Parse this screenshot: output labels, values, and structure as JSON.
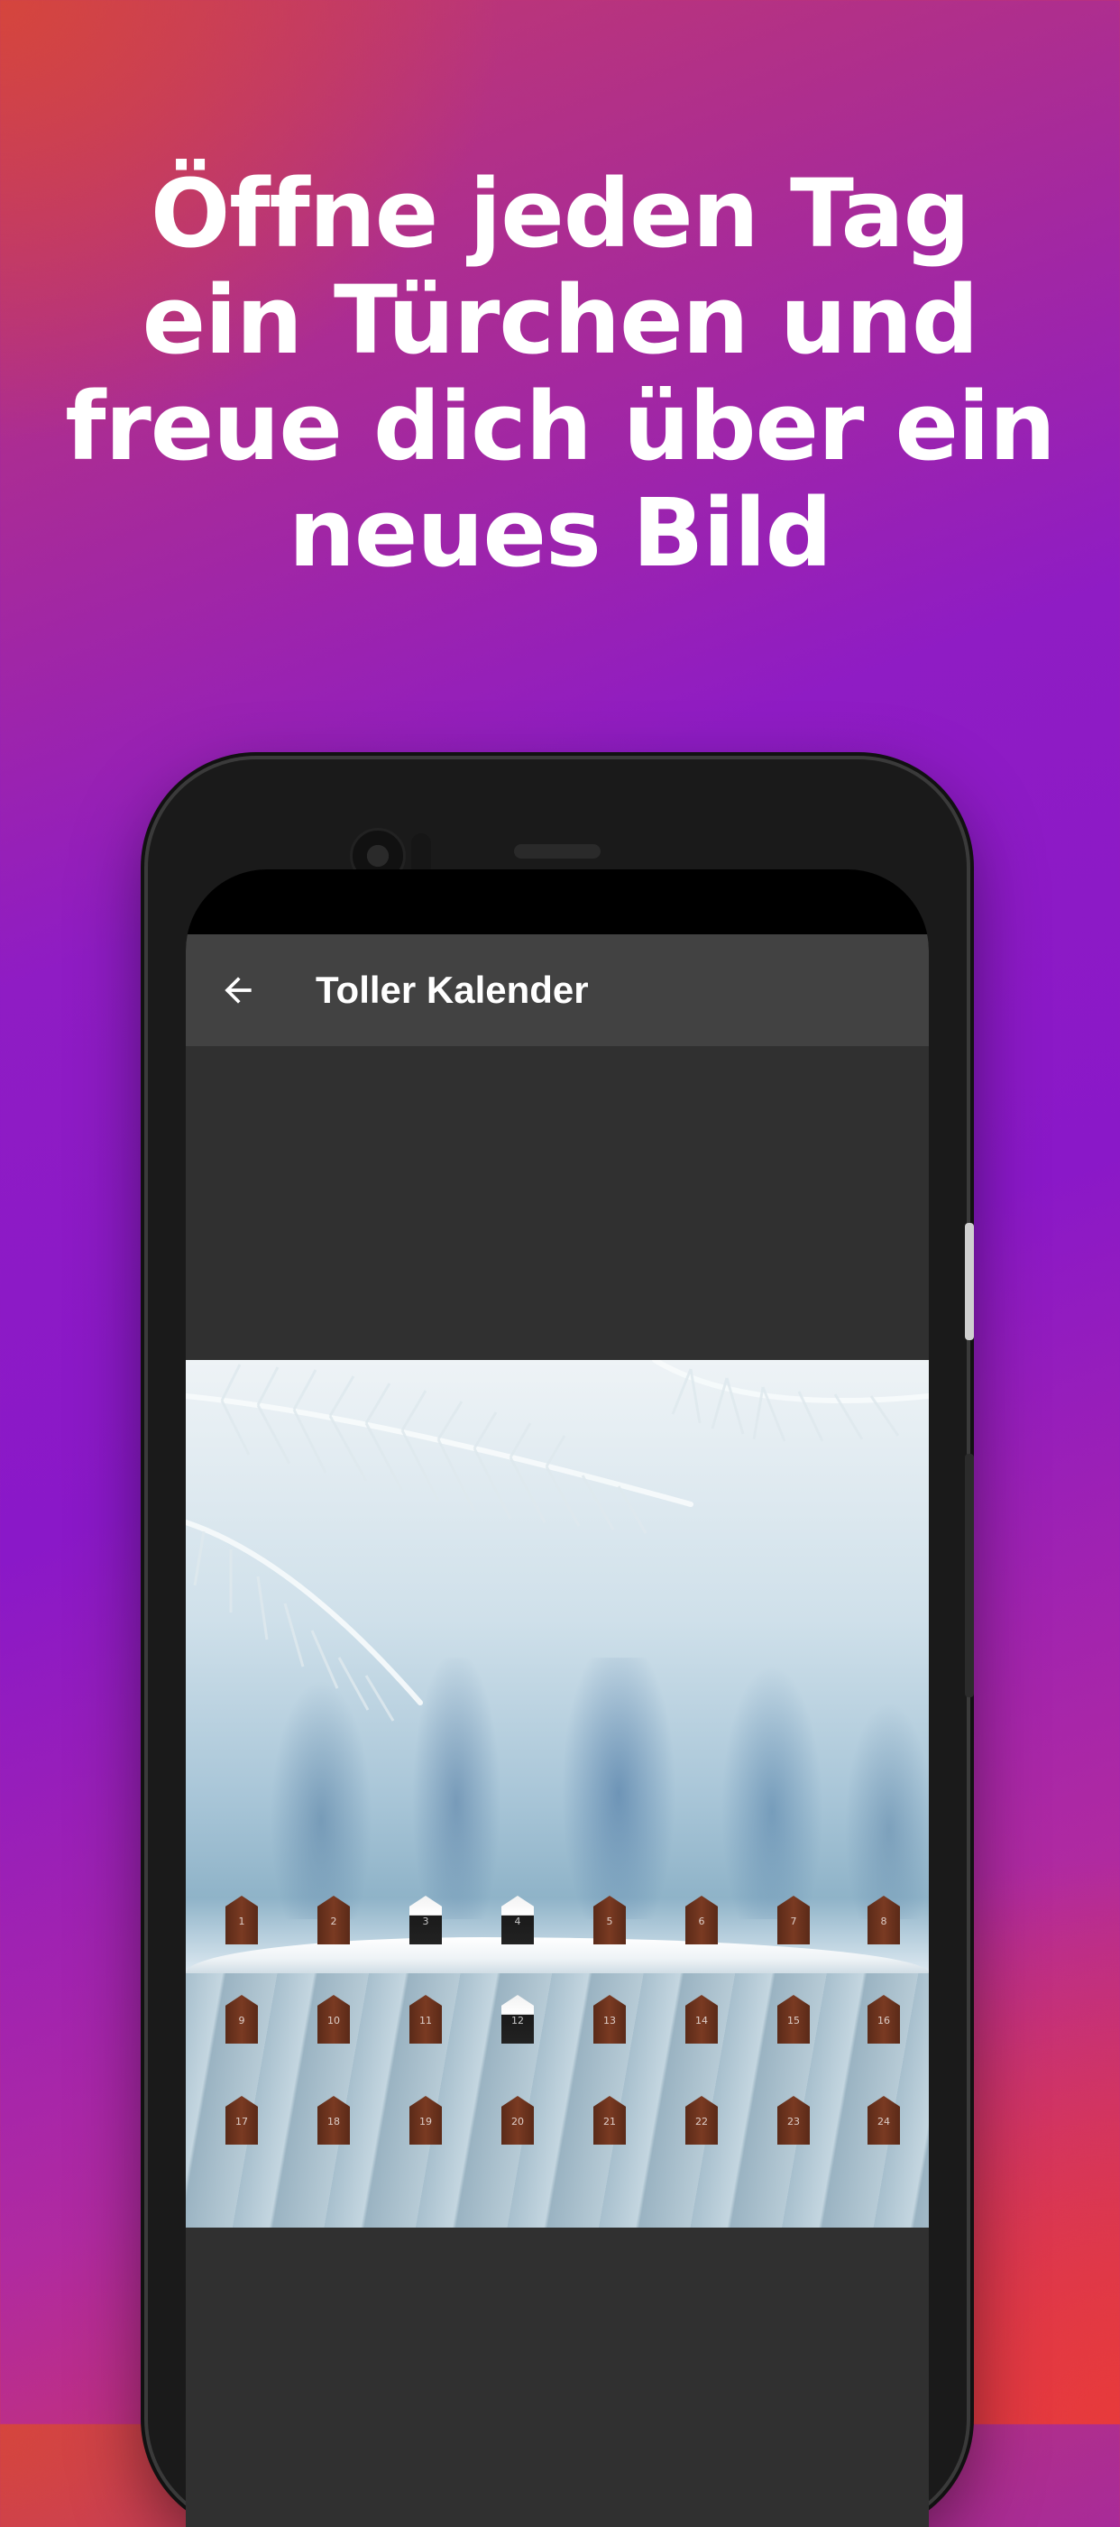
{
  "headline": {
    "lines": [
      "Öffne jeden Tag",
      "ein Türchen und",
      "freue dich über ein",
      "neues Bild"
    ]
  },
  "appbar": {
    "title": "Toller Kalender",
    "back_icon": "arrow-left-icon"
  },
  "calendar": {
    "doors": [
      {
        "number": "1",
        "open": false
      },
      {
        "number": "2",
        "open": false
      },
      {
        "number": "3",
        "open": true
      },
      {
        "number": "4",
        "open": true
      },
      {
        "number": "5",
        "open": false
      },
      {
        "number": "6",
        "open": false
      },
      {
        "number": "7",
        "open": false
      },
      {
        "number": "8",
        "open": false
      },
      {
        "number": "9",
        "open": false
      },
      {
        "number": "10",
        "open": false
      },
      {
        "number": "11",
        "open": false
      },
      {
        "number": "12",
        "open": true
      },
      {
        "number": "13",
        "open": false
      },
      {
        "number": "14",
        "open": false
      },
      {
        "number": "15",
        "open": false
      },
      {
        "number": "16",
        "open": false
      },
      {
        "number": "17",
        "open": false
      },
      {
        "number": "18",
        "open": false
      },
      {
        "number": "19",
        "open": false
      },
      {
        "number": "20",
        "open": false
      },
      {
        "number": "21",
        "open": false
      },
      {
        "number": "22",
        "open": false
      },
      {
        "number": "23",
        "open": false
      },
      {
        "number": "24",
        "open": false
      }
    ]
  },
  "colors": {
    "appbar": "#424242",
    "content_bg": "#303030",
    "door_wood": "#6a3220"
  }
}
